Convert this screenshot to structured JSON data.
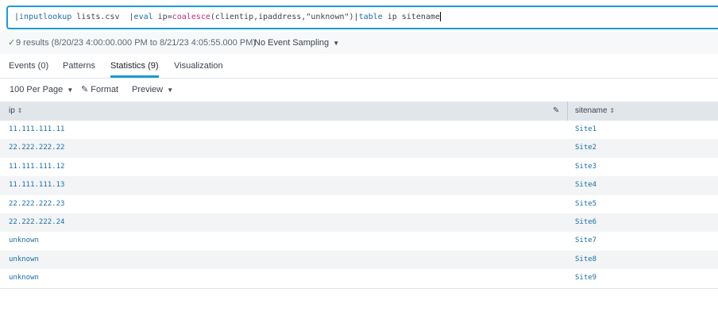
{
  "query": {
    "p1": "|",
    "cmd1": "inputlookup",
    "arg1": " lists.csv  ",
    "p2": "|",
    "cmd2": "eval",
    "arg2a": " ip=",
    "fn": "coalesce",
    "arg2b": "(clientip,ipaddress,\"unknown\")",
    "p3": "|",
    "cmd3": "table",
    "arg3": " ip sitename"
  },
  "status": {
    "check": "✓",
    "results": "9 results (8/20/23 4:00:00.000 PM to 8/21/23 4:05:55.000 PM)",
    "sampling": "No Event Sampling"
  },
  "tabs": [
    {
      "label": "Events (0)"
    },
    {
      "label": "Patterns"
    },
    {
      "label": "Statistics (9)"
    },
    {
      "label": "Visualization"
    }
  ],
  "toolbar": {
    "per_page": "100 Per Page",
    "format": "Format",
    "preview": "Preview"
  },
  "table": {
    "columns": [
      "ip",
      "sitename"
    ],
    "rows": [
      {
        "ip": "11.111.111.11",
        "sitename": "Site1"
      },
      {
        "ip": "22.222.222.22",
        "sitename": "Site2"
      },
      {
        "ip": "11.111.111.12",
        "sitename": "Site3"
      },
      {
        "ip": "11.111.111.13",
        "sitename": "Site4"
      },
      {
        "ip": "22.222.222.23",
        "sitename": "Site5"
      },
      {
        "ip": "22.222.222.24",
        "sitename": "Site6"
      },
      {
        "ip": "unknown",
        "sitename": "Site7"
      },
      {
        "ip": "unknown",
        "sitename": "Site8"
      },
      {
        "ip": "unknown",
        "sitename": "Site9"
      }
    ]
  },
  "colors": {
    "accent": "#1a9bd7",
    "link": "#1a6ea8",
    "command": "#1a6ea8",
    "function": "#c4297a"
  },
  "icons": {
    "check": "check-icon",
    "pencil": "pencil-icon",
    "sort": "sort-icon",
    "dropdown": "chevron-down-icon"
  }
}
